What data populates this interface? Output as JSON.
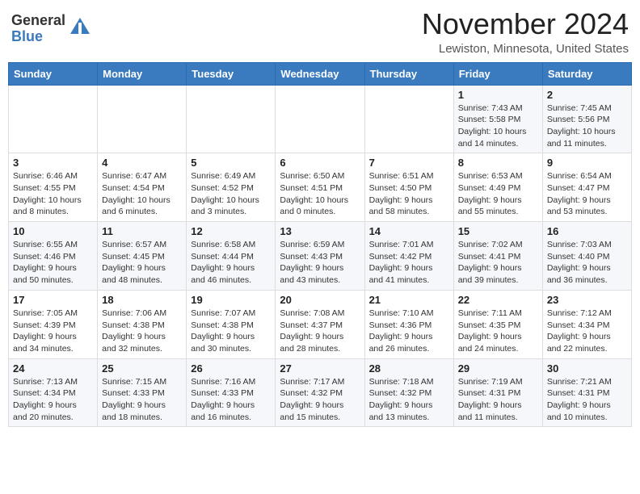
{
  "header": {
    "logo_general": "General",
    "logo_blue": "Blue",
    "month": "November 2024",
    "location": "Lewiston, Minnesota, United States"
  },
  "days_of_week": [
    "Sunday",
    "Monday",
    "Tuesday",
    "Wednesday",
    "Thursday",
    "Friday",
    "Saturday"
  ],
  "weeks": [
    [
      {
        "day": "",
        "info": ""
      },
      {
        "day": "",
        "info": ""
      },
      {
        "day": "",
        "info": ""
      },
      {
        "day": "",
        "info": ""
      },
      {
        "day": "",
        "info": ""
      },
      {
        "day": "1",
        "info": "Sunrise: 7:43 AM\nSunset: 5:58 PM\nDaylight: 10 hours\nand 14 minutes."
      },
      {
        "day": "2",
        "info": "Sunrise: 7:45 AM\nSunset: 5:56 PM\nDaylight: 10 hours\nand 11 minutes."
      }
    ],
    [
      {
        "day": "3",
        "info": "Sunrise: 6:46 AM\nSunset: 4:55 PM\nDaylight: 10 hours\nand 8 minutes."
      },
      {
        "day": "4",
        "info": "Sunrise: 6:47 AM\nSunset: 4:54 PM\nDaylight: 10 hours\nand 6 minutes."
      },
      {
        "day": "5",
        "info": "Sunrise: 6:49 AM\nSunset: 4:52 PM\nDaylight: 10 hours\nand 3 minutes."
      },
      {
        "day": "6",
        "info": "Sunrise: 6:50 AM\nSunset: 4:51 PM\nDaylight: 10 hours\nand 0 minutes."
      },
      {
        "day": "7",
        "info": "Sunrise: 6:51 AM\nSunset: 4:50 PM\nDaylight: 9 hours\nand 58 minutes."
      },
      {
        "day": "8",
        "info": "Sunrise: 6:53 AM\nSunset: 4:49 PM\nDaylight: 9 hours\nand 55 minutes."
      },
      {
        "day": "9",
        "info": "Sunrise: 6:54 AM\nSunset: 4:47 PM\nDaylight: 9 hours\nand 53 minutes."
      }
    ],
    [
      {
        "day": "10",
        "info": "Sunrise: 6:55 AM\nSunset: 4:46 PM\nDaylight: 9 hours\nand 50 minutes."
      },
      {
        "day": "11",
        "info": "Sunrise: 6:57 AM\nSunset: 4:45 PM\nDaylight: 9 hours\nand 48 minutes."
      },
      {
        "day": "12",
        "info": "Sunrise: 6:58 AM\nSunset: 4:44 PM\nDaylight: 9 hours\nand 46 minutes."
      },
      {
        "day": "13",
        "info": "Sunrise: 6:59 AM\nSunset: 4:43 PM\nDaylight: 9 hours\nand 43 minutes."
      },
      {
        "day": "14",
        "info": "Sunrise: 7:01 AM\nSunset: 4:42 PM\nDaylight: 9 hours\nand 41 minutes."
      },
      {
        "day": "15",
        "info": "Sunrise: 7:02 AM\nSunset: 4:41 PM\nDaylight: 9 hours\nand 39 minutes."
      },
      {
        "day": "16",
        "info": "Sunrise: 7:03 AM\nSunset: 4:40 PM\nDaylight: 9 hours\nand 36 minutes."
      }
    ],
    [
      {
        "day": "17",
        "info": "Sunrise: 7:05 AM\nSunset: 4:39 PM\nDaylight: 9 hours\nand 34 minutes."
      },
      {
        "day": "18",
        "info": "Sunrise: 7:06 AM\nSunset: 4:38 PM\nDaylight: 9 hours\nand 32 minutes."
      },
      {
        "day": "19",
        "info": "Sunrise: 7:07 AM\nSunset: 4:38 PM\nDaylight: 9 hours\nand 30 minutes."
      },
      {
        "day": "20",
        "info": "Sunrise: 7:08 AM\nSunset: 4:37 PM\nDaylight: 9 hours\nand 28 minutes."
      },
      {
        "day": "21",
        "info": "Sunrise: 7:10 AM\nSunset: 4:36 PM\nDaylight: 9 hours\nand 26 minutes."
      },
      {
        "day": "22",
        "info": "Sunrise: 7:11 AM\nSunset: 4:35 PM\nDaylight: 9 hours\nand 24 minutes."
      },
      {
        "day": "23",
        "info": "Sunrise: 7:12 AM\nSunset: 4:34 PM\nDaylight: 9 hours\nand 22 minutes."
      }
    ],
    [
      {
        "day": "24",
        "info": "Sunrise: 7:13 AM\nSunset: 4:34 PM\nDaylight: 9 hours\nand 20 minutes."
      },
      {
        "day": "25",
        "info": "Sunrise: 7:15 AM\nSunset: 4:33 PM\nDaylight: 9 hours\nand 18 minutes."
      },
      {
        "day": "26",
        "info": "Sunrise: 7:16 AM\nSunset: 4:33 PM\nDaylight: 9 hours\nand 16 minutes."
      },
      {
        "day": "27",
        "info": "Sunrise: 7:17 AM\nSunset: 4:32 PM\nDaylight: 9 hours\nand 15 minutes."
      },
      {
        "day": "28",
        "info": "Sunrise: 7:18 AM\nSunset: 4:32 PM\nDaylight: 9 hours\nand 13 minutes."
      },
      {
        "day": "29",
        "info": "Sunrise: 7:19 AM\nSunset: 4:31 PM\nDaylight: 9 hours\nand 11 minutes."
      },
      {
        "day": "30",
        "info": "Sunrise: 7:21 AM\nSunset: 4:31 PM\nDaylight: 9 hours\nand 10 minutes."
      }
    ]
  ]
}
